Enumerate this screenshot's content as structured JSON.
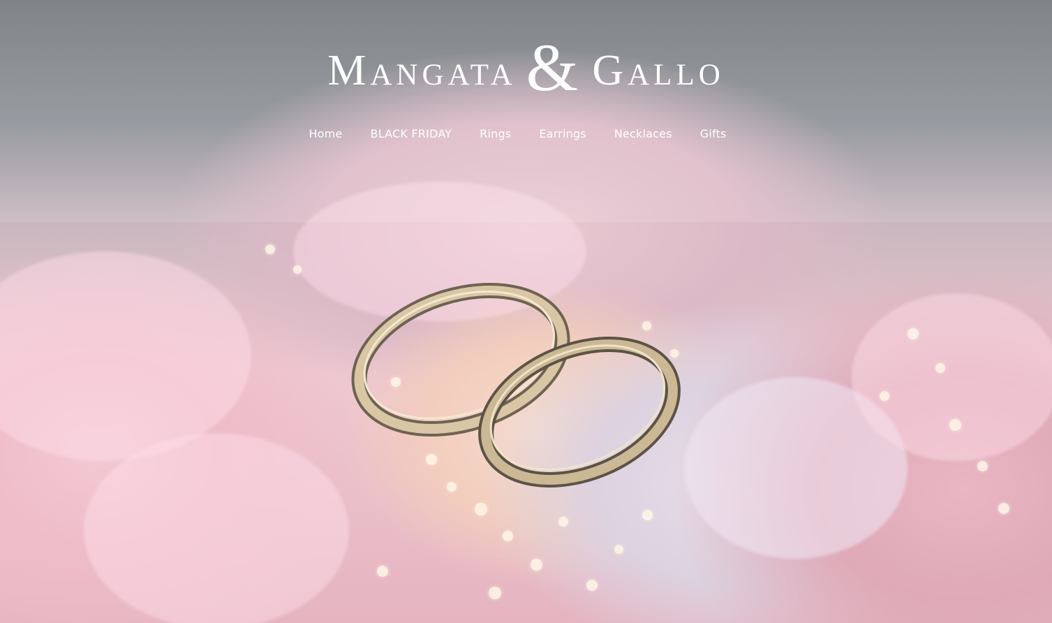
{
  "brand": {
    "name_left": "Mangata",
    "ampersand": "&",
    "name_right": "Gallo"
  },
  "nav": {
    "items": [
      {
        "label": "Home"
      },
      {
        "label": "BLACK FRIDAY"
      },
      {
        "label": "Rings"
      },
      {
        "label": "Earrings"
      },
      {
        "label": "Necklaces"
      },
      {
        "label": "Gifts"
      }
    ]
  },
  "hero": {
    "image": "wedding-rings-on-pink-flowers",
    "colors": {
      "top": "#6e7479",
      "petal_pink": "#efc9d2",
      "ring_gold": "#c9b48f"
    }
  }
}
